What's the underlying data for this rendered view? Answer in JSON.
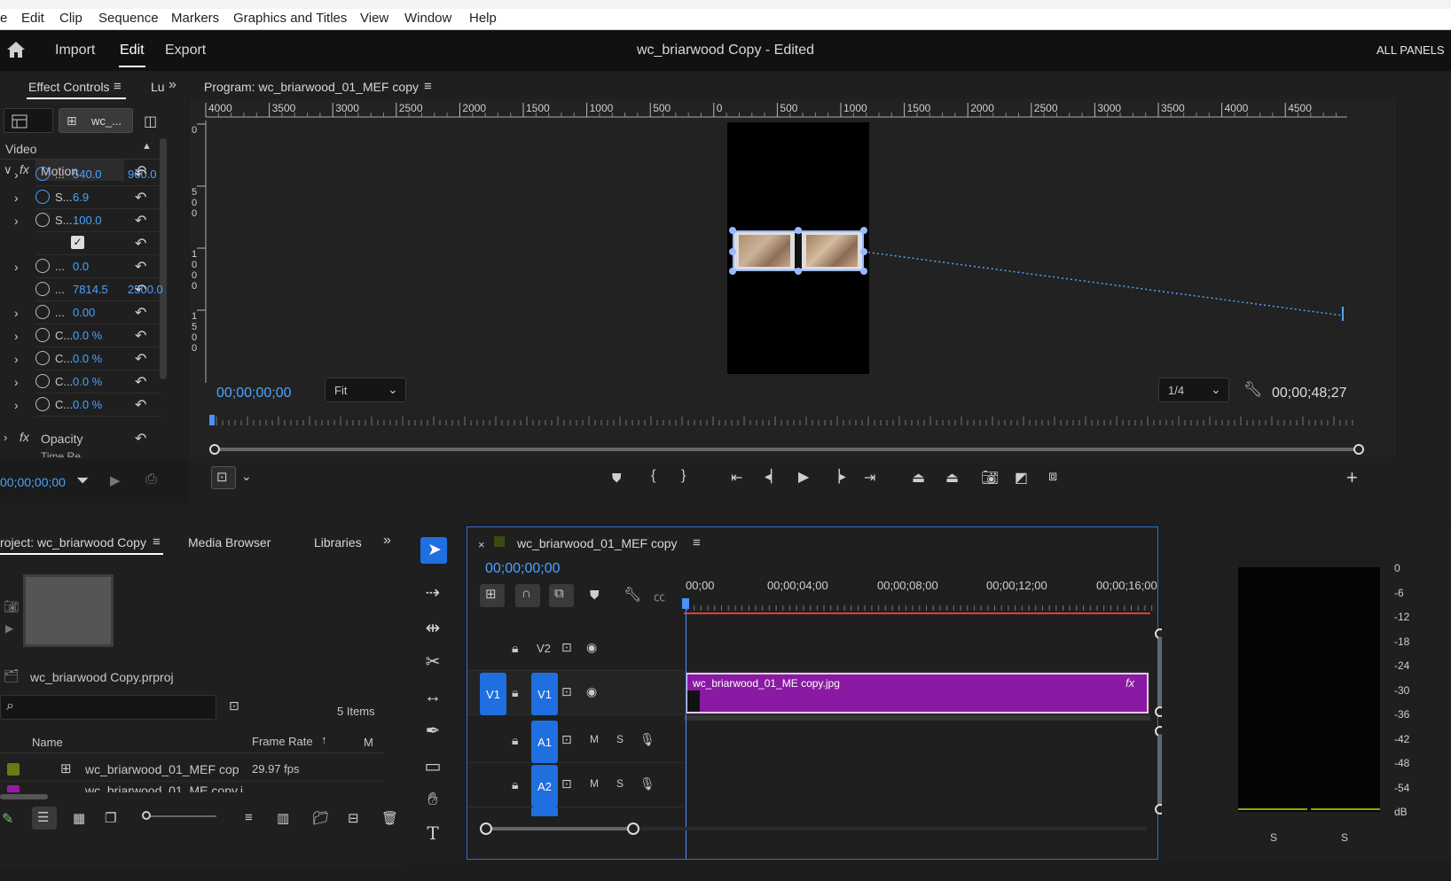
{
  "menubar": {
    "items": [
      "e",
      "Edit",
      "Clip",
      "Sequence",
      "Markers",
      "Graphics and Titles",
      "View",
      "Window",
      "Help"
    ]
  },
  "header": {
    "nav": [
      "Import",
      "Edit",
      "Export"
    ],
    "title": "wc_briarwood Copy",
    "title_suffix": " - Edited",
    "all_panels": "ALL PANELS"
  },
  "effect_controls": {
    "tab": "Effect Controls",
    "tab2": "Lu",
    "clip_chip": "wc_...",
    "section_video": "Video",
    "motion": "Motion",
    "opacity": "Opacity",
    "time_remap": "Time Re",
    "rows": [
      {
        "lbl": "...",
        "v1": "540.0",
        "v2": "960.0"
      },
      {
        "lbl": "S...",
        "v1": "6.9",
        "v2": ""
      },
      {
        "lbl": "S...",
        "v1": "100.0",
        "v2": ""
      },
      {
        "lbl": "",
        "v1": "",
        "v2": ""
      },
      {
        "lbl": "...",
        "v1": "0.0",
        "v2": ""
      },
      {
        "lbl": "...",
        "v1": "7814.5",
        "v2": "2500.0"
      },
      {
        "lbl": "...",
        "v1": "0.00",
        "v2": ""
      },
      {
        "lbl": "C...",
        "v1": "0.0 %",
        "v2": ""
      },
      {
        "lbl": "C...",
        "v1": "0.0 %",
        "v2": ""
      },
      {
        "lbl": "C...",
        "v1": "0.0 %",
        "v2": ""
      },
      {
        "lbl": "C...",
        "v1": "0.0 %",
        "v2": ""
      }
    ],
    "timecode": "00;00;00;00"
  },
  "program_monitor": {
    "title": "Program: wc_briarwood_01_MEF copy",
    "ruler_labels": [
      "4000",
      "3500",
      "3000",
      "2500",
      "2000",
      "1500",
      "1000",
      "500",
      "0",
      "500",
      "1000",
      "1500",
      "2000",
      "2500",
      "3000",
      "3500",
      "4000",
      "4500"
    ],
    "vruler_labels": [
      "0",
      "500",
      "1000",
      "1500"
    ],
    "timecode_left": "00;00;00;00",
    "fit": "Fit",
    "resolution": "1/4",
    "timecode_right": "00;00;48;27"
  },
  "project": {
    "tab": "roject: wc_briarwood Copy",
    "tab2": "Media Browser",
    "tab3": "Libraries",
    "file": "wc_briarwood Copy.prproj",
    "items_count": "5 Items",
    "col_name": "Name",
    "col_frame_rate": "Frame Rate",
    "col_m": "M",
    "rows": [
      {
        "name": "wc_briarwood_01_MEF cop",
        "rate": "29.97 fps"
      },
      {
        "name": "wc_briarwood_01_ME copy.j",
        "rate": ""
      }
    ]
  },
  "timeline": {
    "tab": "wc_briarwood_01_MEF copy",
    "timecode": "00;00;00;00",
    "ruler": [
      "00;00",
      "00;00;04;00",
      "00;00;08;00",
      "00;00;12;00",
      "00;00;16;00"
    ],
    "tracks": {
      "v2": "V2",
      "v1": "V1",
      "v1_src": "V1",
      "a1": "A1",
      "a2": "A2",
      "m": "M",
      "s": "S"
    },
    "clip": "wc_briarwood_01_ME copy.jpg",
    "clip_fx": "fx"
  },
  "meter": {
    "labels": [
      "0",
      "-6",
      "-12",
      "-18",
      "-24",
      "-30",
      "-36",
      "-42",
      "-48",
      "-54",
      "dB"
    ],
    "solo": [
      "S",
      "S"
    ]
  },
  "colors": {
    "accent": "#4aa3ff",
    "clip": "#8a1aa3",
    "track_btn": "#1f6fe0"
  }
}
